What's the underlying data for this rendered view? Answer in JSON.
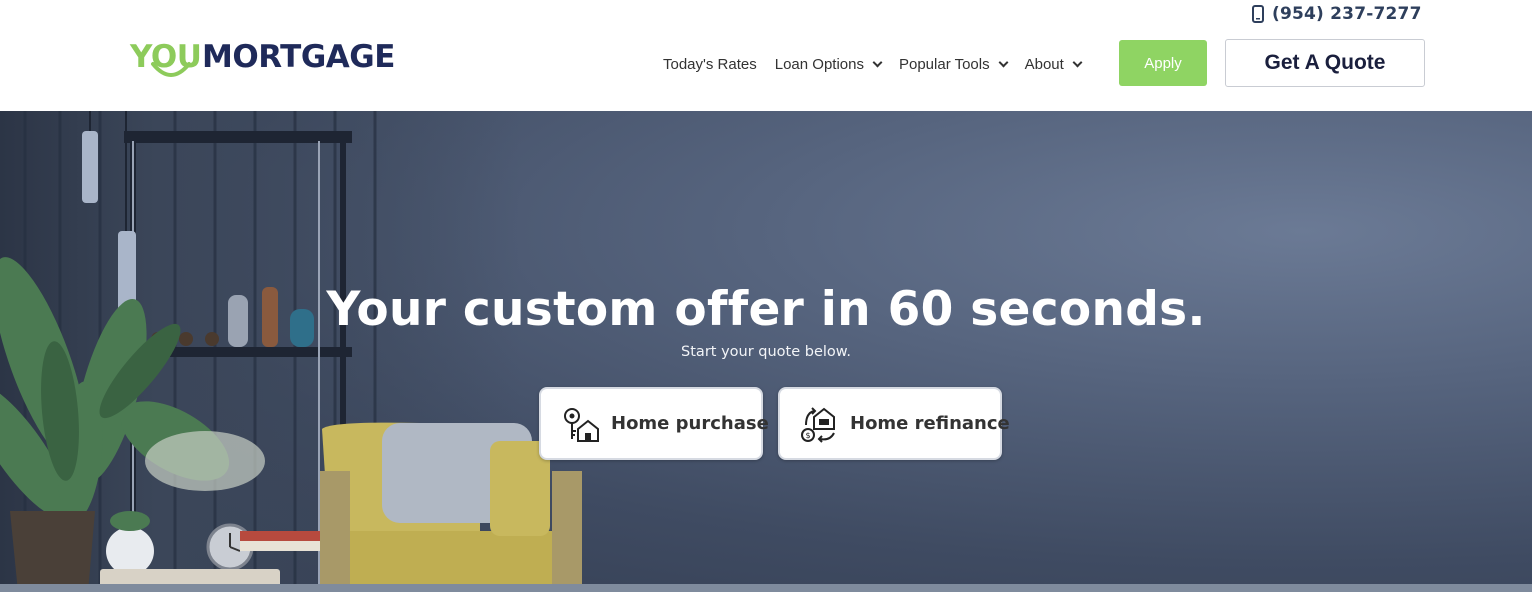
{
  "header": {
    "phone": "(954) 237-7277",
    "logo": {
      "part1": "YOU",
      "part2": "MORTGAGE"
    },
    "nav": [
      {
        "label": "Today's Rates",
        "has_dropdown": false
      },
      {
        "label": "Loan Options",
        "has_dropdown": true
      },
      {
        "label": "Popular Tools",
        "has_dropdown": true
      },
      {
        "label": "About",
        "has_dropdown": true
      }
    ],
    "apply_label": "Apply",
    "quote_label": "Get A Quote"
  },
  "hero": {
    "title": "Your custom offer in 60 seconds.",
    "subtitle": "Start your quote below.",
    "options": [
      {
        "label": "Home purchase",
        "icon": "keys-house-icon"
      },
      {
        "label": "Home refinance",
        "icon": "refinance-house-icon"
      }
    ]
  },
  "colors": {
    "brand_green": "#8dcb5b",
    "brand_navy": "#1f2a5a",
    "apply_green": "#8fd463",
    "hero_bg": "#4a566d"
  }
}
